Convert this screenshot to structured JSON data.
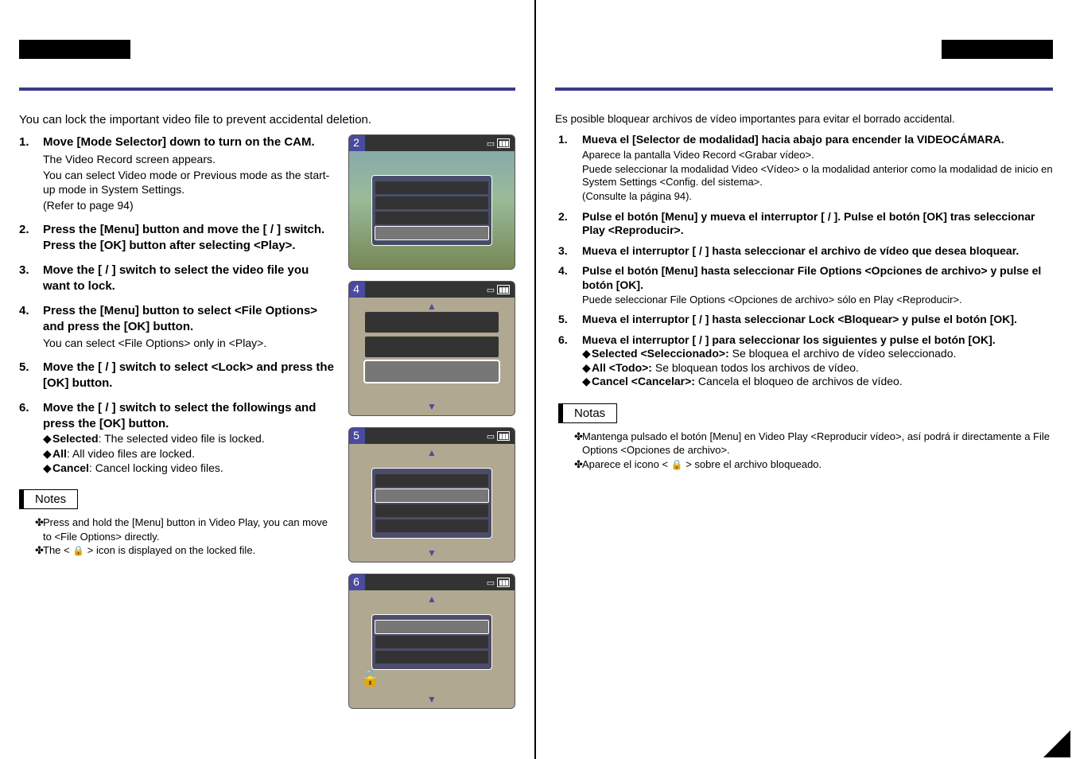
{
  "left": {
    "intro": "You can lock the important video file to prevent accidental deletion.",
    "steps": [
      {
        "num": "1.",
        "title": "Move [Mode Selector] down to turn on the CAM.",
        "subs": [
          "The Video Record screen appears.",
          "You can select Video mode or Previous mode as the start-up mode in System Settings.",
          "(Refer to page 94)"
        ]
      },
      {
        "num": "2.",
        "title": "Press the [Menu] button and move the [   /   ] switch.",
        "title2": "Press the [OK] button after selecting <Play>."
      },
      {
        "num": "3.",
        "title": "Move the [   /   ] switch to select the video file you want to lock."
      },
      {
        "num": "4.",
        "title": "Press the [Menu] button to select <File Options> and press the [OK] button.",
        "subs": [
          "You can select <File Options> only in <Play>."
        ]
      },
      {
        "num": "5.",
        "title": "Move the [   /   ] switch to select <Lock> and press the [OK] button."
      },
      {
        "num": "6.",
        "title": "Move the [   /   ] switch to select the followings and press the [OK] button.",
        "bullets": [
          {
            "label": "Selected",
            "text": ": The selected video file is locked."
          },
          {
            "label": "All",
            "text": ": All video files are locked."
          },
          {
            "label": "Cancel",
            "text": ": Cancel locking video files."
          }
        ]
      }
    ],
    "notes_label": "Notes",
    "notes": [
      "Press and hold the [Menu] button in Video Play, you can move to <File Options> directly.",
      "The <      > icon is displayed on the locked file."
    ]
  },
  "right": {
    "intro": "Es posible bloquear archivos de vídeo importantes para evitar el borrado accidental.",
    "steps": [
      {
        "num": "1.",
        "title": "Mueva el [Selector de modalidad] hacia abajo para encender la VIDEOCÁMARA.",
        "subs": [
          "Aparece la pantalla Video Record <Grabar vídeo>.",
          "Puede seleccionar la modalidad Video <Vídeo> o la modalidad anterior como la modalidad de inicio en System Settings <Config. del sistema>.",
          "(Consulte la página 94)."
        ]
      },
      {
        "num": "2.",
        "title": "Pulse el botón [Menu] y mueva el interruptor [   /   ]. Pulse el botón [OK] tras seleccionar Play <Reproducir>."
      },
      {
        "num": "3.",
        "title": "Mueva el interruptor [   /   ] hasta seleccionar el archivo de vídeo que desea bloquear."
      },
      {
        "num": "4.",
        "title": "Pulse el botón [Menu] hasta seleccionar File Options <Opciones de archivo> y pulse el botón [OK].",
        "subs": [
          "Puede seleccionar File Options <Opciones de archivo> sólo en Play <Reproducir>."
        ]
      },
      {
        "num": "5.",
        "title": "Mueva el interruptor [   /   ] hasta seleccionar Lock <Bloquear> y pulse el botón [OK]."
      },
      {
        "num": "6.",
        "title": "Mueva el interruptor [   /   ] para seleccionar los siguientes y pulse el botón [OK].",
        "bullets": [
          {
            "label": "Selected <Seleccionado>:",
            "text": " Se bloquea el archivo de vídeo seleccionado."
          },
          {
            "label": "All <Todo>:",
            "text": " Se bloquean todos los archivos de vídeo."
          },
          {
            "label": "Cancel <Cancelar>:",
            "text": " Cancela el bloqueo de archivos de vídeo."
          }
        ]
      }
    ],
    "notes_label": "Notas",
    "notes": [
      "Mantenga pulsado el botón [Menu] en Video Play <Reproducir vídeo>, así podrá ir directamente a File Options <Opciones de archivo>.",
      "Aparece el icono <      > sobre el archivo bloqueado."
    ]
  },
  "screens": {
    "s2": "2",
    "s4": "4",
    "s5": "5",
    "s6": "6"
  }
}
